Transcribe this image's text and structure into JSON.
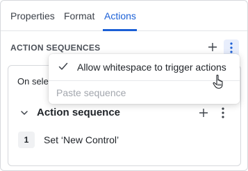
{
  "tabs": [
    {
      "label": "Properties",
      "active": false
    },
    {
      "label": "Format",
      "active": false
    },
    {
      "label": "Actions",
      "active": true
    }
  ],
  "section": {
    "title": "ACTION SEQUENCES",
    "add_icon": "plus-icon",
    "more_icon": "kebab-icon"
  },
  "card": {
    "trigger_text": "On selec",
    "sequence": {
      "title": "Action sequence",
      "steps": [
        {
          "number": "1",
          "label": "Set ‘New Control’"
        }
      ]
    }
  },
  "menu": {
    "items": [
      {
        "label": "Allow whitespace to trigger actions",
        "checked": true,
        "disabled": false
      },
      {
        "label": "Paste sequence",
        "checked": false,
        "disabled": true
      }
    ]
  },
  "colors": {
    "accent": "#1a5fd6",
    "active_button_bg": "#e8eefc",
    "disabled_text": "#a2a6ad"
  }
}
